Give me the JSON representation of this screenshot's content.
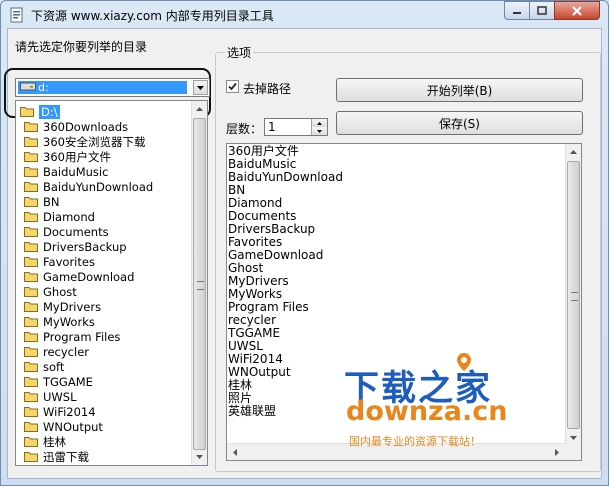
{
  "window": {
    "title": "下资源 www.xiazy.com 内部专用列目录工具"
  },
  "left": {
    "prompt": "请先选定你要列举的目录",
    "drive": "d:",
    "tree": [
      {
        "name": "D:\\",
        "selected": true
      },
      {
        "name": "360Downloads"
      },
      {
        "name": "360安全浏览器下载"
      },
      {
        "name": "360用户文件"
      },
      {
        "name": "BaiduMusic"
      },
      {
        "name": "BaiduYunDownload"
      },
      {
        "name": "BN"
      },
      {
        "name": "Diamond"
      },
      {
        "name": "Documents"
      },
      {
        "name": "DriversBackup"
      },
      {
        "name": "Favorites"
      },
      {
        "name": "GameDownload"
      },
      {
        "name": "Ghost"
      },
      {
        "name": "MyDrivers"
      },
      {
        "name": "MyWorks"
      },
      {
        "name": "Program Files"
      },
      {
        "name": "recycler"
      },
      {
        "name": "soft"
      },
      {
        "name": "TGGAME"
      },
      {
        "name": "UWSL"
      },
      {
        "name": "WiFi2014"
      },
      {
        "name": "WNOutput"
      },
      {
        "name": "桂林"
      },
      {
        "name": "迅雷下载"
      }
    ]
  },
  "options": {
    "group_title": "选项",
    "strip_path_label": "去掉路径",
    "strip_path_checked": true,
    "depth_label": "层数：",
    "depth_value": "1",
    "start_button": "开始列举(B)",
    "save_button": "保存(S)"
  },
  "results": [
    "360用户文件",
    "BaiduMusic",
    "BaiduYunDownload",
    "BN",
    "Diamond",
    "Documents",
    "DriversBackup",
    "Favorites",
    "GameDownload",
    "Ghost",
    "MyDrivers",
    "MyWorks",
    "Program Files",
    "recycler",
    "TGGAME",
    "UWSL",
    "WiFi2014",
    "WNOutput",
    "桂林",
    "照片",
    "英雄联盟"
  ],
  "watermark": {
    "title": "下载之家",
    "domain": "downza.cn",
    "slogan": "国内最专业的资源下载站！"
  },
  "colors": {
    "selection": "#3399ff",
    "folder": "#f5d66a",
    "watermark_blue": "#1d5dbd",
    "watermark_orange": "#e8861c"
  }
}
